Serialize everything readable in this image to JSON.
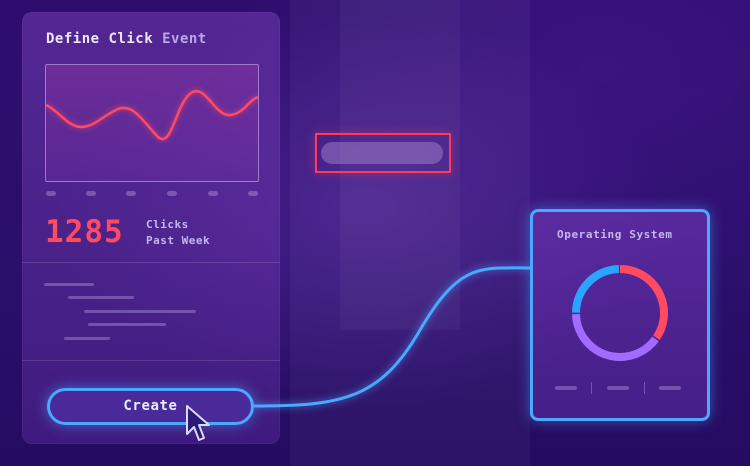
{
  "define_panel": {
    "title_main": "Define Click",
    "title_muted": "Event",
    "clicks_value": "1285",
    "clicks_label_line1": "Clicks",
    "clicks_label_line2": "Past Week",
    "create_label": "Create"
  },
  "os_panel": {
    "title": "Operating System",
    "segments": [
      {
        "name": "red",
        "fraction": 0.35,
        "color": "#ff4a62"
      },
      {
        "name": "purple",
        "fraction": 0.4,
        "color": "#a26bff"
      },
      {
        "name": "blue",
        "fraction": 0.25,
        "color": "#2aa4ff"
      }
    ]
  },
  "colors": {
    "accent_blue": "#4aa8ff",
    "accent_red": "#ff4a62",
    "background": "#2a0f6b"
  }
}
